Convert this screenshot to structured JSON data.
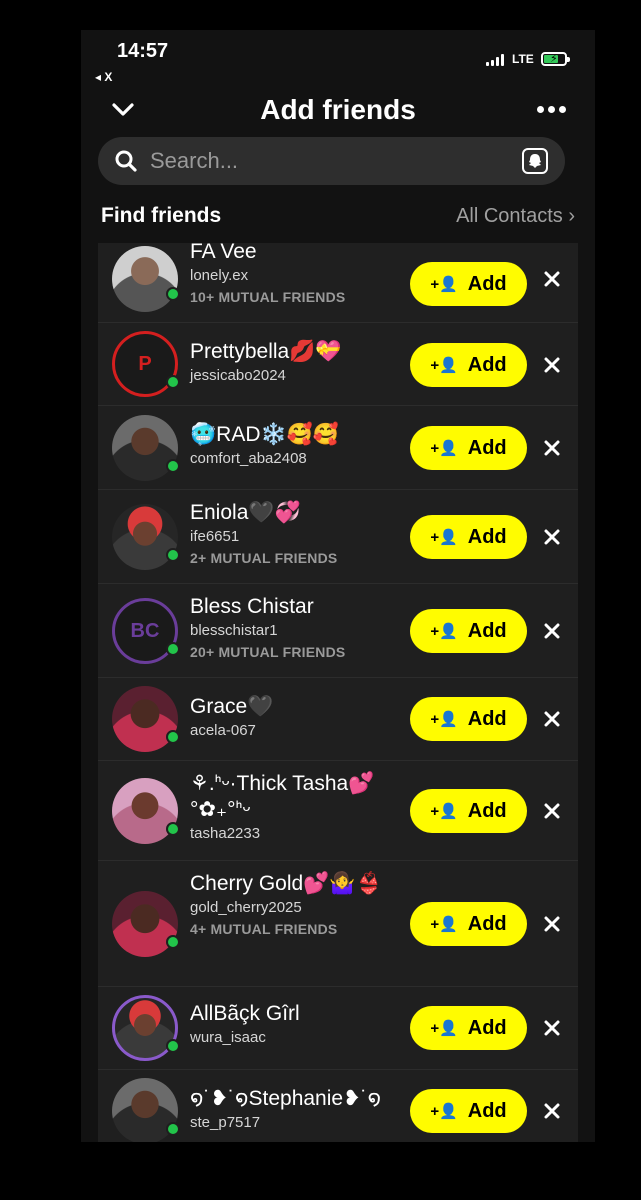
{
  "status_bar": {
    "time": "14:57",
    "back_app": "◂ X",
    "network": "LTE"
  },
  "header": {
    "title": "Add friends"
  },
  "search": {
    "placeholder": "Search..."
  },
  "section": {
    "title": "Find friends",
    "link": "All Contacts ›"
  },
  "add_label": "Add",
  "friends": [
    {
      "name": "FA Vee",
      "username": "lonely.ex",
      "mutual": "10+ MUTUAL FRIENDS"
    },
    {
      "name": "Prettybella💋💝",
      "username": "jessicabo2024",
      "mutual": "",
      "initial": "P"
    },
    {
      "name": "🥶RAD❄️🥰🥰",
      "username": "comfort_aba2408",
      "mutual": ""
    },
    {
      "name": "Eniola🖤💞",
      "username": "ife6651",
      "mutual": "2+ MUTUAL FRIENDS"
    },
    {
      "name": "Bless Chistar",
      "username": "blesschistar1",
      "mutual": "20+ MUTUAL FRIENDS",
      "initial": "BC"
    },
    {
      "name": "Grace🖤",
      "username": "acela-067",
      "mutual": ""
    },
    {
      "name": "⚘.ᑋᵕ·Thick Tasha💕 °✿₊°ᑋᵕ",
      "username": "tasha2233",
      "mutual": ""
    },
    {
      "name": "Cherry Gold💕🤷‍♀️👙",
      "username": "gold_cherry2025",
      "mutual": "4+ MUTUAL FRIENDS"
    },
    {
      "name": "AllBãçk Gîrl",
      "username": "wura_isaac",
      "mutual": ""
    },
    {
      "name": "໑˙❥˙໑Stephanie❥˙໑",
      "username": "ste_p7517",
      "mutual": ""
    }
  ]
}
